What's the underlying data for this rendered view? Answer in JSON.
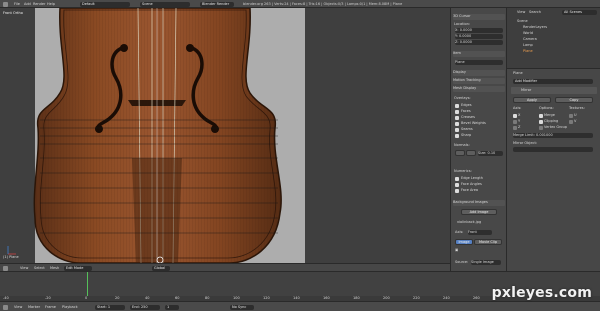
{
  "app": {
    "menus": [
      "File",
      "Add",
      "Render",
      "Help"
    ],
    "screen_layout": "Default",
    "scene": "Scene",
    "render_engine": "Blender Render",
    "stats": "blender.org 263 | Verts:24 | Faces:8 | Tris:16 | Objects:0/3 | Lamps:0/1 | Mem:8.08M | Plane"
  },
  "viewport": {
    "label": "Front Ortho",
    "object_label": "(1) Plane",
    "footer": {
      "menus": [
        "View",
        "Select",
        "Mesh"
      ],
      "mode": "Edit Mode",
      "pivot": "Global"
    }
  },
  "transform_panel": {
    "header": "3D Cursor",
    "location_label": "Location:",
    "x": "X: 0.0000",
    "y": "Y: 0.0000",
    "z": "Z: 0.0000",
    "item_header": "Item",
    "item_value": "Plane",
    "display_header": "Display",
    "motion_tracking": "Motion Tracking",
    "mesh_display": "Mesh Display",
    "overlays_label": "Overlays:",
    "overlays": [
      "Edges",
      "Faces",
      "Creases",
      "Bevel Weights",
      "Seams",
      "Sharp"
    ],
    "normals_label": "Normals:",
    "normals_size": "Size: 0.10",
    "numerics_label": "Numerics:",
    "numerics": [
      "Edge Length",
      "Face Angles",
      "Face Area"
    ],
    "background_images": "Background Images",
    "add_image": "Add Image",
    "image_name": "violinback.jpg",
    "axis_label": "Axis:",
    "axis_value": "Front",
    "image_tab": "Image",
    "movie_clip_tab": "Movie Clip",
    "source_label": "Source:",
    "source_value": "Single Image"
  },
  "outliner": {
    "menus": [
      "View",
      "Search",
      "All Scenes"
    ],
    "items": [
      "Scene",
      "RenderLayers",
      "World",
      "Camera",
      "Lamp",
      "Plane"
    ]
  },
  "properties": {
    "object": "Plane",
    "add_modifier": "Add Modifier",
    "modifier_name": "Mirror",
    "apply": "Apply",
    "copy": "Copy",
    "axis_label": "Axis:",
    "options_label": "Options:",
    "textures_label": "Textures:",
    "axes": [
      "X",
      "Y",
      "Z"
    ],
    "options": [
      "Merge",
      "Clipping",
      "Vertex Group"
    ],
    "textures": [
      "U",
      "V"
    ],
    "merge_limit": "Merge Limit: 0.001000",
    "mirror_object": "Mirror Object:"
  },
  "timeline": {
    "ticks": [
      "-40",
      "-20",
      "0",
      "20",
      "40",
      "60",
      "80",
      "100",
      "120",
      "140",
      "160",
      "180",
      "200",
      "220",
      "240",
      "260"
    ],
    "footer": {
      "menus": [
        "View",
        "Marker",
        "Frame",
        "Playback"
      ],
      "start": "Start: 1",
      "end": "End: 250",
      "current": "1",
      "sync": "No Sync"
    }
  },
  "watermark": "pxleyes.com"
}
